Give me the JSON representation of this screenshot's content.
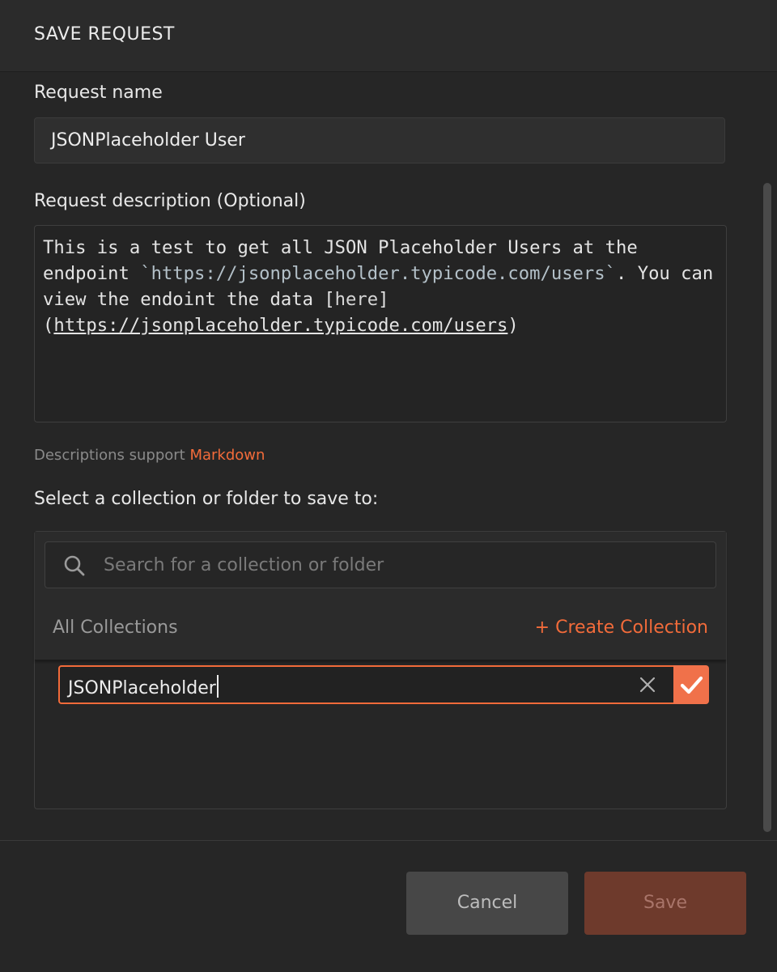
{
  "header": {
    "title": "SAVE REQUEST"
  },
  "request_name": {
    "label": "Request name",
    "value": "JSONPlaceholder User"
  },
  "request_description": {
    "label": "Request description (Optional)",
    "text_before": "This is a test to get all JSON Placeholder Users at the endpoint ",
    "code": "`https://jsonplaceholder.typicode.com/users`",
    "text_middle": ". You can view the endoint the data ",
    "link_open": "[",
    "link_text": "here",
    "link_mid": "](",
    "link_url": "https://jsonplaceholder.typicode.com/users",
    "link_close": ")"
  },
  "markdown_hint": {
    "text": "Descriptions support",
    "link": "Markdown"
  },
  "collections": {
    "label": "Select a collection or folder to save to:",
    "search_placeholder": "Search for a collection or folder",
    "all_label": "All Collections",
    "create_label": "+ Create Collection",
    "new_collection_value": "JSONPlaceholder"
  },
  "footer": {
    "cancel_label": "Cancel",
    "save_label": "Save"
  },
  "colors": {
    "accent": "#f26b3a",
    "background": "#262626",
    "save_disabled": "#6e3a2c"
  }
}
